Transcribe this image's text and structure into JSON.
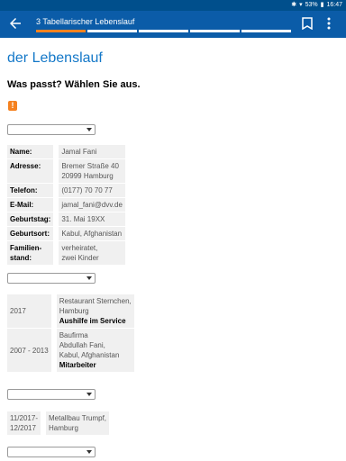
{
  "statusbar": {
    "battery": "53%",
    "time": "16:47"
  },
  "appbar": {
    "title": "3 Tabellarischer Lebenslauf",
    "progress": {
      "segments": 6,
      "active": 1
    }
  },
  "page": {
    "heading": "der Lebenslauf",
    "question": "Was passt? Wählen Sie aus.",
    "warning_icon": "!"
  },
  "personal": [
    {
      "label": "Name:",
      "value": "Jamal Fani"
    },
    {
      "label": "Adresse:",
      "value": "Bremer Straße 40\n20999 Hamburg"
    },
    {
      "label": "Telefon:",
      "value": "(0177) 70 70 77"
    },
    {
      "label": "E-Mail:",
      "value": "jamal_fani@dvv.de"
    },
    {
      "label": "Geburtstag:",
      "value": "31. Mai 19XX"
    },
    {
      "label": "Geburtsort:",
      "value": "Kabul, Afghanistan"
    },
    {
      "label": "Familien-\nstand:",
      "value": "verheiratet,\nzwei Kinder"
    }
  ],
  "experience": [
    {
      "period": "2017",
      "place": "Restaurant Sternchen,\nHamburg",
      "role": "Aushilfe im Service"
    },
    {
      "period": "2007 - 2013",
      "place": "Baufirma\nAbdullah Fani,\nKabul, Afghanistan",
      "role": "Mitarbeiter"
    }
  ],
  "experience2": [
    {
      "period": "11/2017-\n12/2017",
      "place": "Metallbau Trumpf,\nHamburg"
    }
  ],
  "colors": {
    "appbar": "#0b5ca8",
    "statusbar": "#004f8c",
    "accent": "#f58220",
    "heading": "#1478c8"
  }
}
